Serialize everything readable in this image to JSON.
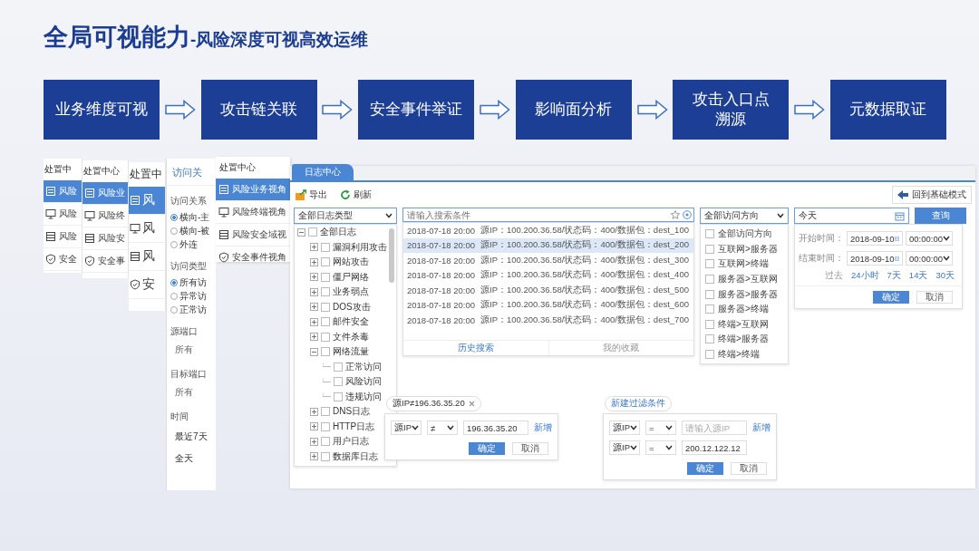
{
  "title": {
    "main": "全局可视能力",
    "sub": "-风险深度可视高效运维"
  },
  "flow_steps": [
    "业务维度可视",
    "攻击链关联",
    "安全事件举证",
    "影响面分析",
    "攻击入口点溯源",
    "元数据取证"
  ],
  "screenshot": {
    "menu_panels": [
      {
        "header": "处置中",
        "items": [
          {
            "label": "风险",
            "selected": true
          },
          {
            "label": "风险",
            "selected": false
          },
          {
            "label": "风险",
            "selected": false
          },
          {
            "label": "安全",
            "selected": false
          }
        ]
      },
      {
        "header": "处置中心",
        "items": [
          {
            "label": "风险业",
            "selected": true
          },
          {
            "label": "风险终",
            "selected": false
          },
          {
            "label": "风险安",
            "selected": false
          },
          {
            "label": "安全事",
            "selected": false
          }
        ]
      },
      {
        "header": "处置中",
        "items": [
          {
            "label": "风",
            "selected": true
          },
          {
            "label": "风",
            "selected": false
          },
          {
            "label": "风",
            "selected": false
          },
          {
            "label": "安",
            "selected": false
          }
        ]
      }
    ],
    "filter_panel": {
      "tab": "访问关",
      "groups": [
        {
          "title": "访问关系",
          "options": [
            {
              "label": "横向-主",
              "selected": true
            },
            {
              "label": "横向-被",
              "selected": false
            },
            {
              "label": "外连",
              "selected": false
            }
          ]
        },
        {
          "title": "访问类型",
          "options": [
            {
              "label": "所有访",
              "selected": true
            },
            {
              "label": "异常访",
              "selected": false
            },
            {
              "label": "正常访",
              "selected": false
            }
          ]
        }
      ],
      "fields": [
        {
          "label": "源端口",
          "value": "所有"
        },
        {
          "label": "目标端口",
          "value": "所有"
        }
      ],
      "time": {
        "label": "时间",
        "values": [
          "最近7天",
          "全天"
        ]
      }
    },
    "view_menu": {
      "header": "处置中心",
      "items": [
        {
          "label": "风险业务视角",
          "selected": true
        },
        {
          "label": "风险终端视角",
          "selected": false
        },
        {
          "label": "风险安全域视",
          "selected": false
        },
        {
          "label": "安全事件视角",
          "selected": false
        }
      ]
    },
    "log_center": {
      "tab": "日志中心",
      "toolbar": [
        "导出",
        "刷新"
      ],
      "back_button": "回到基础模式",
      "log_type_select": "全部日志类型",
      "tree": [
        {
          "label": "全部日志",
          "expanded": true,
          "checked": false,
          "children": [
            {
              "label": "漏洞利用攻击",
              "expanded": false,
              "checked": false
            },
            {
              "label": "网站攻击",
              "expanded": false,
              "checked": false
            },
            {
              "label": "僵尸网络",
              "expanded": false,
              "checked": false
            },
            {
              "label": "业务弱点",
              "expanded": false,
              "checked": false
            },
            {
              "label": "DOS攻击",
              "expanded": false,
              "checked": false
            },
            {
              "label": "邮件安全",
              "expanded": false,
              "checked": false
            },
            {
              "label": "文件杀毒",
              "expanded": false,
              "checked": false
            },
            {
              "label": "网络流量",
              "expanded": true,
              "checked": false,
              "children": [
                {
                  "label": "正常访问",
                  "checked": false
                },
                {
                  "label": "风险访问",
                  "checked": false
                },
                {
                  "label": "违规访问",
                  "checked": false
                }
              ]
            },
            {
              "label": "DNS日志",
              "expanded": false,
              "checked": false
            },
            {
              "label": "HTTP日志",
              "expanded": false,
              "checked": false
            },
            {
              "label": "用户日志",
              "expanded": false,
              "checked": false
            },
            {
              "label": "数据库日志",
              "expanded": false,
              "checked": false
            }
          ]
        }
      ],
      "search": {
        "placeholder": "请输入搜索条件"
      },
      "results": [
        {
          "time": "2018-07-18 20:00",
          "text": "源IP：100.200.36.58/状态码：400/数据包：dest_100",
          "selected": false
        },
        {
          "time": "2018-07-18 20:00",
          "text": "源IP：100.200.36.58/状态码：400/数据包：dest_200",
          "selected": true
        },
        {
          "time": "2018-07-18 20:00",
          "text": "源IP：100.200.36.58/状态码：400/数据包：dest_300",
          "selected": false
        },
        {
          "time": "2018-07-18 20:00",
          "text": "源IP：100.200.36.58/状态码：400/数据包：dest_400",
          "selected": false
        },
        {
          "time": "2018-07-18 20:00",
          "text": "源IP：100.200.36.58/状态码：400/数据包：dest_500",
          "selected": false
        },
        {
          "time": "2018-07-18 20:00",
          "text": "源IP：100.200.36.58/状态码：400/数据包：dest_600",
          "selected": false
        },
        {
          "time": "2018-07-18 20:00",
          "text": "源IP：100.200.36.58/状态码：400/数据包：dest_700",
          "selected": false
        }
      ],
      "result_tabs": [
        {
          "label": "历史搜索",
          "selected": true
        },
        {
          "label": "我的收藏",
          "selected": false
        }
      ],
      "direction_select": "全部访问方向",
      "directions": [
        {
          "label": "全部访问方向",
          "checked": false
        },
        {
          "label": "互联网>服务器",
          "checked": false
        },
        {
          "label": "互联网>终端",
          "checked": false
        },
        {
          "label": "服务器>互联网",
          "checked": false
        },
        {
          "label": "服务器>服务器",
          "checked": false
        },
        {
          "label": "服务器>终端",
          "checked": false
        },
        {
          "label": "终端>互联网",
          "checked": false
        },
        {
          "label": "终端>服务器",
          "checked": false
        },
        {
          "label": "终端>终端",
          "checked": false
        }
      ],
      "date_field": "今天",
      "query_button": "查询",
      "date_popup": {
        "rows": [
          {
            "label": "开始时间：",
            "date": "2018-09-10",
            "time": "00:00:00"
          },
          {
            "label": "结束时间：",
            "date": "2018-09-10",
            "time": "00:00:00"
          }
        ],
        "past_label": "过去",
        "ranges": [
          "24小时",
          "7天",
          "14天",
          "30天"
        ],
        "ok": "确定",
        "cancel": "取消"
      }
    },
    "filter_popups": [
      {
        "chip": "源IP≠196.36.35.20",
        "chip_closable": true,
        "rows": [
          {
            "field": "源IP",
            "op": "≠",
            "value": "196.36.35.20",
            "add": "新增"
          }
        ],
        "ok": "确定",
        "cancel": "取消"
      },
      {
        "chip": "新建过滤条件",
        "chip_closable": false,
        "rows": [
          {
            "field": "源IP",
            "op": "=",
            "placeholder": "请输入源IP",
            "add": "新增"
          },
          {
            "field": "源IP",
            "op": "=",
            "value": "200.12.122.12"
          }
        ],
        "ok": "确定",
        "cancel": "取消"
      }
    ]
  }
}
